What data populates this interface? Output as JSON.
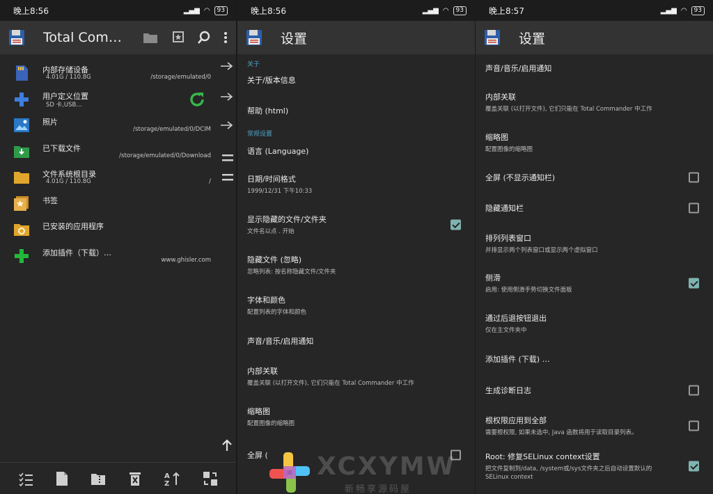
{
  "colors": {
    "accent": "#4fa3c4",
    "checkbox_on": "#7fb3b0",
    "appbar": "#333333",
    "background": "#262626"
  },
  "panel1": {
    "status": {
      "time": "晚上8:56",
      "battery": "93"
    },
    "appbar": {
      "title": "Total Com…"
    },
    "drives": [
      {
        "name": "内部存储设备",
        "size": "4.01G / 110.8G",
        "path": "/storage/emulated/0",
        "icon": "sd-card-icon"
      },
      {
        "name": "用户定义位置",
        "size": "SD 卡,USB…",
        "path": "",
        "icon": "plus-icon"
      },
      {
        "name": "照片",
        "size": "",
        "path": "/storage/emulated/0/DCIM",
        "icon": "photo-icon"
      },
      {
        "name": "已下载文件",
        "size": "",
        "path": "/storage/emulated/0/Download",
        "icon": "download-folder-icon"
      },
      {
        "name": "文件系统根目录",
        "size": "4.01G / 110.8G",
        "path": "/",
        "icon": "folder-icon"
      },
      {
        "name": "书签",
        "size": "",
        "path": "",
        "icon": "bookmark-icon"
      },
      {
        "name": "已安装的应用程序",
        "size": "",
        "path": "",
        "icon": "apps-folder-icon"
      },
      {
        "name": "添加插件（下载）…",
        "size": "",
        "path": "www.ghisler.com",
        "icon": "add-plugin-icon"
      }
    ]
  },
  "panel2": {
    "status": {
      "time": "晚上8:56",
      "battery": "93"
    },
    "appbar": {
      "title": "设置"
    },
    "section_about": "关于",
    "section_general": "常规设置",
    "rows": [
      {
        "title": "关于/版本信息",
        "sub": ""
      },
      {
        "title": "帮助 (html)",
        "sub": ""
      },
      {
        "title": "语言 (Language)",
        "sub": ""
      },
      {
        "title": "日期/时间格式",
        "sub": "1999/12/31  下午10:33"
      },
      {
        "title": "显示隐藏的文件/文件夹",
        "sub": "文件名以点 . 开始",
        "checked": true
      },
      {
        "title": "隐藏文件 (忽略)",
        "sub": "忽略列表: 按名称隐藏文件/文件夹"
      },
      {
        "title": "字体和颜色",
        "sub": "配置列表的字体和颜色"
      },
      {
        "title": "声音/音乐/启用通知",
        "sub": ""
      },
      {
        "title": "内部关联",
        "sub": "覆盖关联 (以打开文件), 它们只能在 Total Commander 中工作"
      },
      {
        "title": "缩略图",
        "sub": "配置图像的缩略图"
      },
      {
        "title": "全屏 (",
        "sub": "",
        "checked": false
      }
    ]
  },
  "panel3": {
    "status": {
      "time": "晚上8:57",
      "battery": "93"
    },
    "appbar": {
      "title": "设置"
    },
    "rows": [
      {
        "title": "声音/音乐/启用通知",
        "sub": ""
      },
      {
        "title": "内部关联",
        "sub": "覆盖关联 (以打开文件), 它们只能在 Total Commander 中工作"
      },
      {
        "title": "缩略图",
        "sub": "配置图像的缩略图"
      },
      {
        "title": "全屏 (不显示通知栏)",
        "sub": "",
        "checked": false
      },
      {
        "title": "隐藏通知栏",
        "sub": "",
        "checked": false
      },
      {
        "title": "排列列表窗口",
        "sub": "并排显示两个列表窗口或显示两个虚拟窗口"
      },
      {
        "title": "侧滑",
        "sub": "启用: 使用侧滑手势切换文件面板",
        "checked": true
      },
      {
        "title": "通过后退按钮退出",
        "sub": "仅在主文件夹中"
      },
      {
        "title": "添加插件 (下载) …",
        "sub": ""
      },
      {
        "title": "生成诊断日志",
        "sub": "",
        "checked": false
      },
      {
        "title": "根权限应用到全部",
        "sub": "需要根权限, 如果未选中, Java 函数将用于读取目录列表。",
        "checked": false
      },
      {
        "title": "Root: 修复SELinux context设置",
        "sub": "把文件复制到/data, /system或/sys文件夹之后自动设置默认的 SELinux context",
        "checked": true
      }
    ]
  },
  "watermark": {
    "text": "XCXYMW",
    "sub": "新畅享源码屋"
  }
}
